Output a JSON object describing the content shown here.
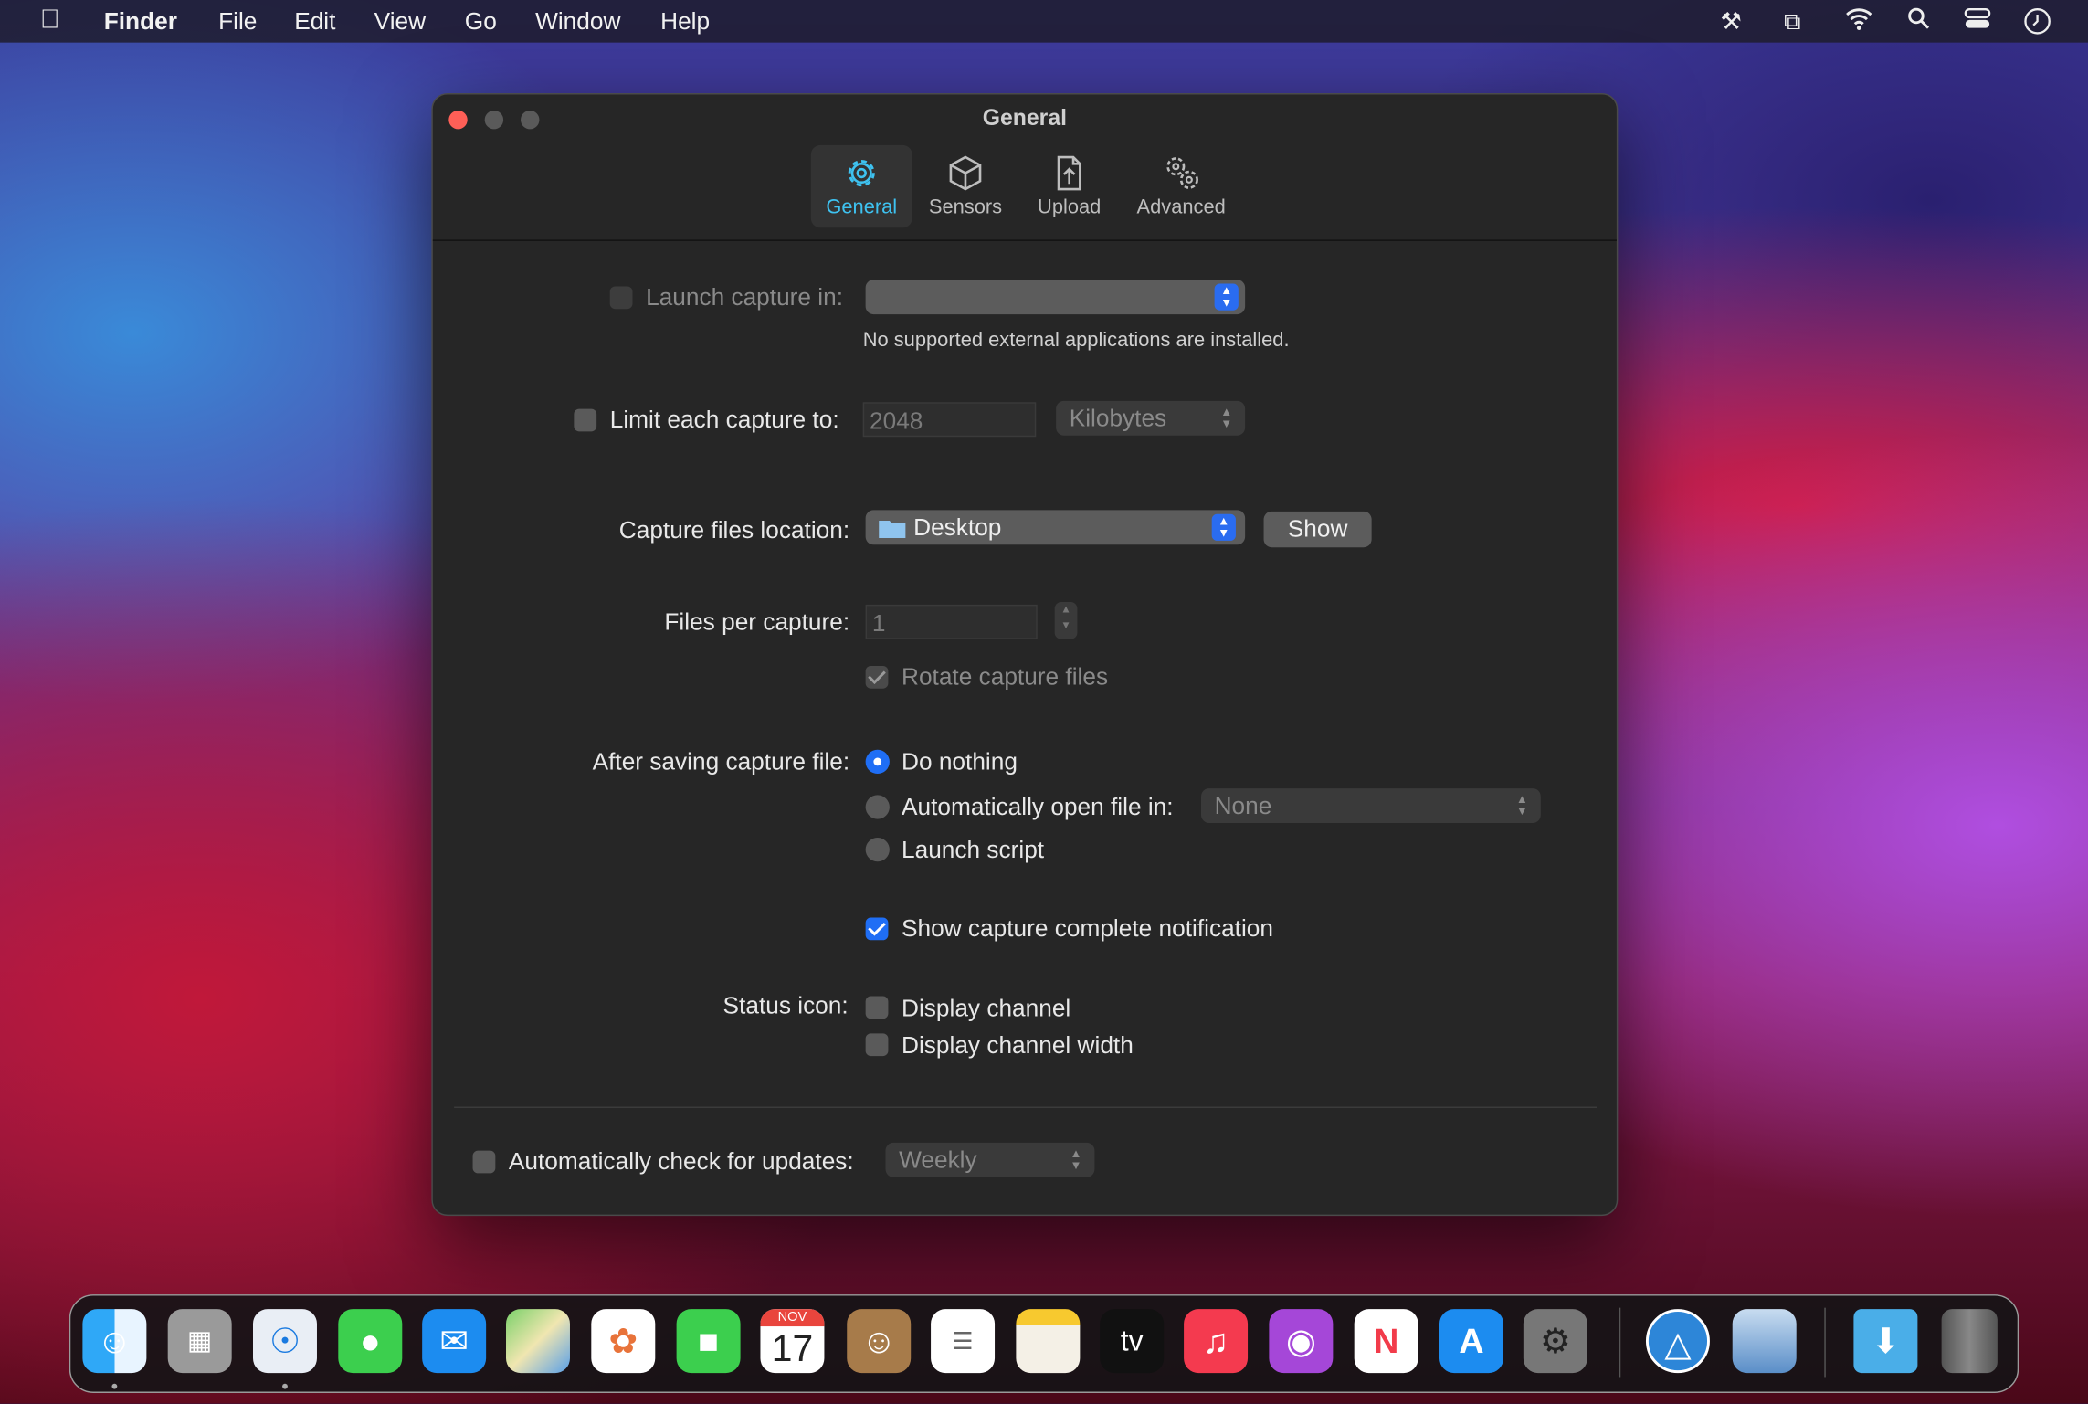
{
  "menubar": {
    "apple_icon": "apple-logo-icon",
    "app": "Finder",
    "items": [
      "File",
      "Edit",
      "View",
      "Go",
      "Window",
      "Help"
    ],
    "status_icons": [
      "tools-icon",
      "screen-mirroring-icon",
      "wifi-icon",
      "search-icon",
      "control-center-icon",
      "clock-icon"
    ]
  },
  "window": {
    "title": "General",
    "tabs": [
      {
        "label": "General",
        "icon": "gear-icon",
        "selected": true
      },
      {
        "label": "Sensors",
        "icon": "cube-icon"
      },
      {
        "label": "Upload",
        "icon": "upload-document-icon"
      },
      {
        "label": "Advanced",
        "icon": "gears-icon"
      }
    ],
    "launch_capture": {
      "label": "Launch capture in:",
      "checked": false,
      "value": "",
      "note": "No supported external applications are installed."
    },
    "limit": {
      "label": "Limit each capture to:",
      "checked": false,
      "value": "2048",
      "unit": "Kilobytes"
    },
    "location": {
      "label": "Capture files location:",
      "value": "Desktop",
      "show_button": "Show"
    },
    "files_per_capture": {
      "label": "Files per capture:",
      "value": "1",
      "rotate_label": "Rotate capture files",
      "rotate_checked": true
    },
    "after_saving": {
      "label": "After saving capture file:",
      "options": [
        "Do nothing",
        "Automatically open file in:",
        "Launch script"
      ],
      "selected": "Do nothing",
      "open_in_value": "None"
    },
    "notification": {
      "label": "Show capture complete notification",
      "checked": true
    },
    "status_icon": {
      "label": "Status icon:",
      "options": [
        {
          "label": "Display channel",
          "checked": false
        },
        {
          "label": "Display channel width",
          "checked": false
        }
      ]
    },
    "updates": {
      "label": "Automatically check for updates:",
      "checked": false,
      "value": "Weekly"
    },
    "accent_color": "#1f6ef5",
    "tab_selected_color": "#3ec2f0"
  },
  "dock": {
    "apps": [
      "finder",
      "launchpad",
      "safari",
      "messages",
      "mail",
      "maps",
      "photos",
      "facetime",
      "calendar",
      "contacts",
      "reminders",
      "notes",
      "apple-tv",
      "music",
      "podcasts",
      "news",
      "app-store",
      "system-preferences",
      "wifi-explorer",
      "preview",
      "downloads",
      "trash"
    ],
    "calendar": {
      "month": "NOV",
      "day": "17"
    },
    "tv_label": "tv"
  }
}
